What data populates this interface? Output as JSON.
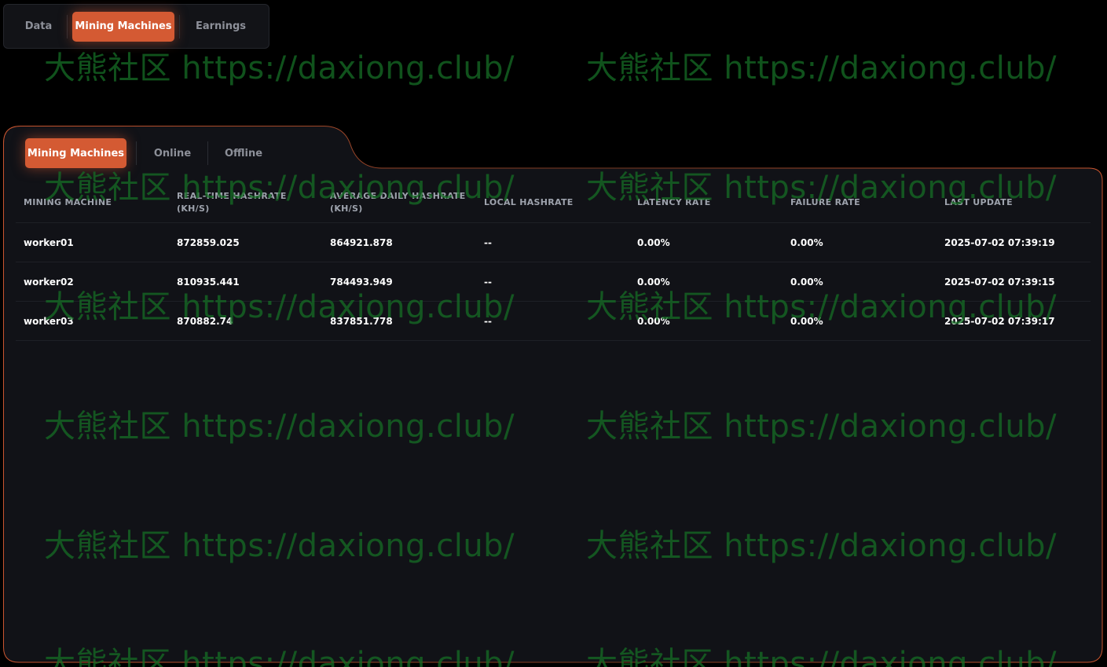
{
  "top_tabs": [
    {
      "label": "Data",
      "active": false
    },
    {
      "label": "Mining Machines",
      "active": true
    },
    {
      "label": "Earnings",
      "active": false
    }
  ],
  "sub_tabs": [
    {
      "label": "Mining Machines",
      "active": true
    },
    {
      "label": "Online",
      "active": false
    },
    {
      "label": "Offline",
      "active": false
    }
  ],
  "table": {
    "headers": {
      "machine": "MINING MACHINE",
      "realtime": "REAL-TIME HASHRATE",
      "realtime_unit": "(KH/S)",
      "average": "AVERAGE DAILY HASHRATE",
      "average_unit": "(KH/S)",
      "local": "LOCAL HASHRATE",
      "latency": "LATENCY RATE",
      "failure": "FAILURE RATE",
      "updated": "LAST UPDATE"
    },
    "rows": [
      {
        "machine": "worker01",
        "realtime": "872859.025",
        "average": "864921.878",
        "local": "--",
        "latency": "0.00%",
        "failure": "0.00%",
        "updated": "2025-07-02 07:39:19"
      },
      {
        "machine": "worker02",
        "realtime": "810935.441",
        "average": "784493.949",
        "local": "--",
        "latency": "0.00%",
        "failure": "0.00%",
        "updated": "2025-07-02 07:39:15"
      },
      {
        "machine": "worker03",
        "realtime": "870882.74",
        "average": "837851.778",
        "local": "--",
        "latency": "0.00%",
        "failure": "0.00%",
        "updated": "2025-07-02 07:39:17"
      }
    ]
  },
  "watermark": "大熊社区 https://daxiong.club/",
  "colors": {
    "accent": "#d45a33",
    "background": "#000000",
    "panel": "#111217",
    "watermark": "#166e26"
  }
}
